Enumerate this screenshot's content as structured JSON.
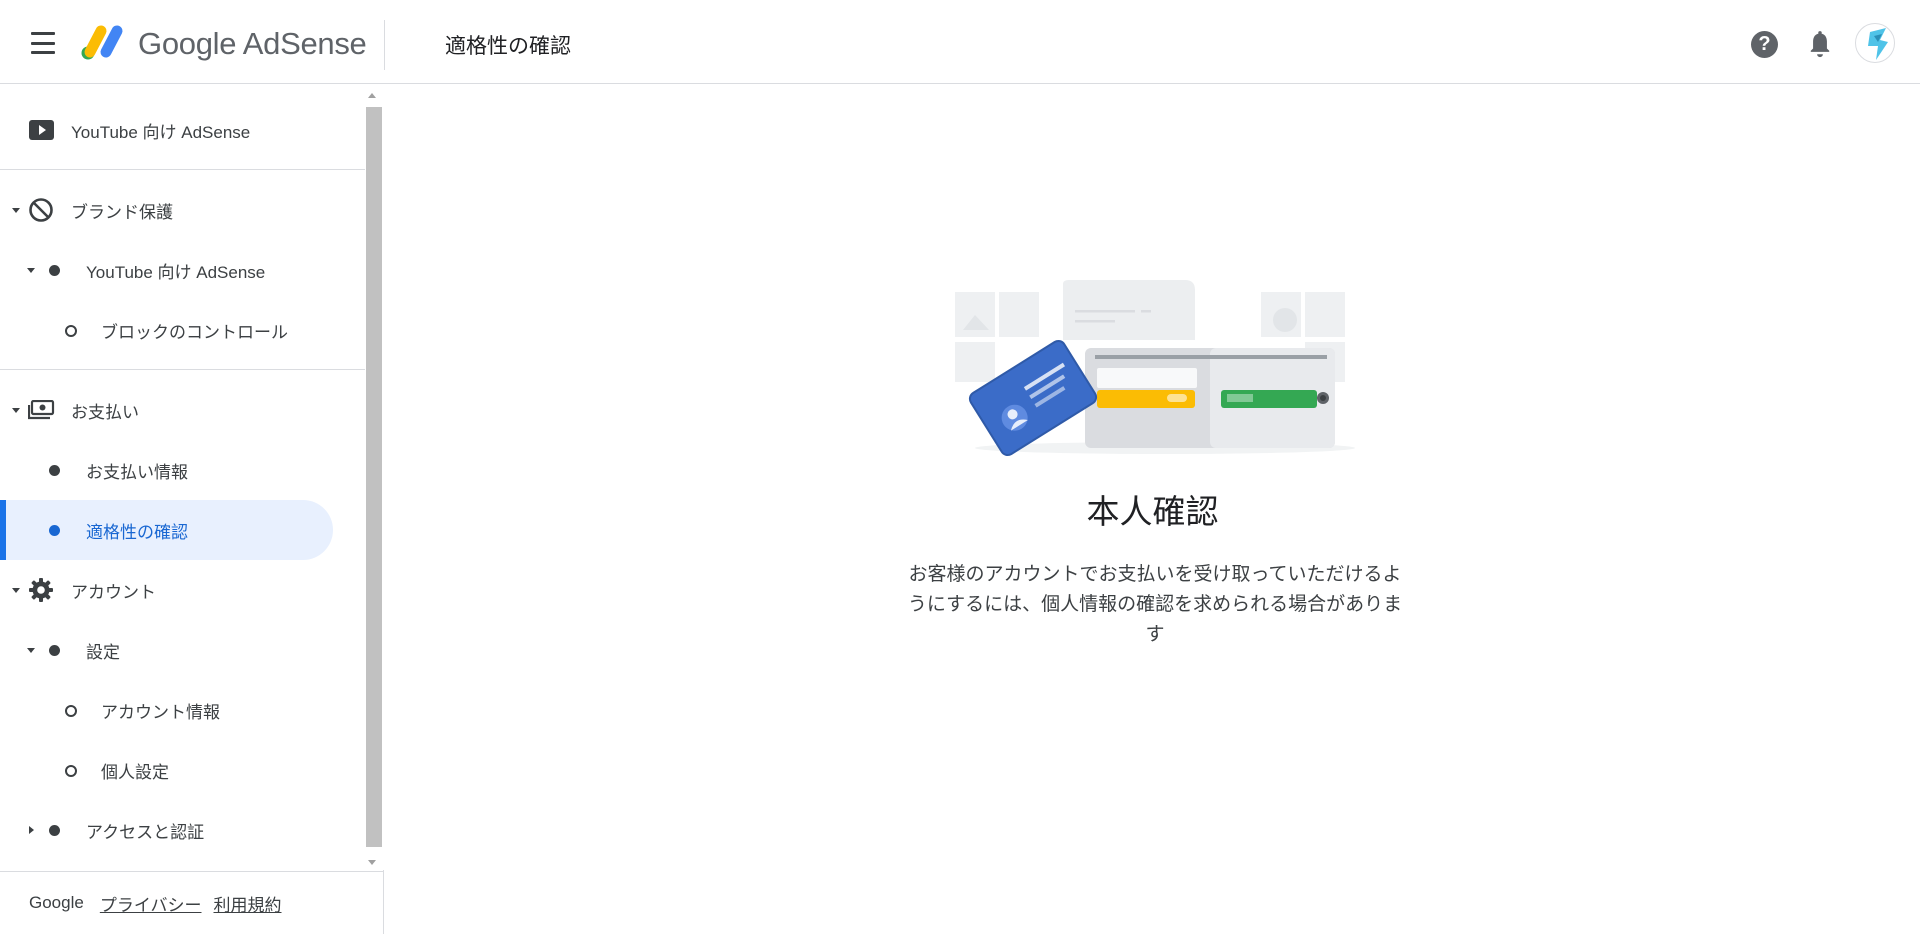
{
  "header": {
    "logo_text": "Google AdSense",
    "page_title": "適格性の確認",
    "help_icon": "?"
  },
  "sidebar": {
    "items": [
      {
        "label": "YouTube 向け AdSense",
        "icon": "youtube-icon"
      },
      {
        "label": "ブランド保護",
        "icon": "block-icon"
      },
      {
        "label": "YouTube 向け AdSense"
      },
      {
        "label": "ブロックのコントロール"
      },
      {
        "label": "お支払い",
        "icon": "payments-icon"
      },
      {
        "label": "お支払い情報"
      },
      {
        "label": "適格性の確認",
        "active": true
      },
      {
        "label": "アカウント",
        "icon": "gear-icon"
      },
      {
        "label": "設定"
      },
      {
        "label": "アカウント情報"
      },
      {
        "label": "個人設定"
      },
      {
        "label": "アクセスと認証"
      }
    ],
    "footer": {
      "google": "Google",
      "privacy": "プライバシー",
      "terms": "利用規約"
    }
  },
  "main": {
    "title": "本人確認",
    "description": "お客様のアカウントでお支払いを受け取っていただけるようにするには、個人情報の確認を求められる場合があります"
  },
  "colors": {
    "accent": "#1a73e8",
    "active_bg": "#e8f0fe",
    "logo_yellow": "#fbbc04",
    "logo_blue": "#4285f4",
    "logo_green": "#34a853"
  }
}
